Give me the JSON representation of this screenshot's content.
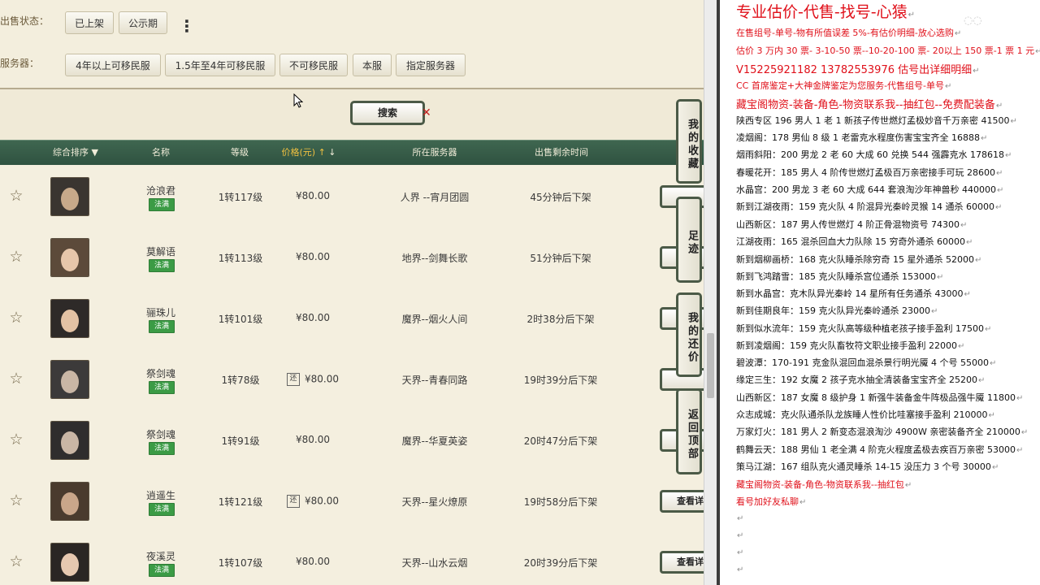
{
  "filters": {
    "sale_status_label": "出售状态：",
    "sale_status_options": [
      "已上架",
      "公示期"
    ],
    "server_label": "服务器：",
    "server_options": [
      "4年以上可移民服",
      "1.5年至4年可移民服",
      "不可移民服",
      "本服",
      "指定服务器"
    ]
  },
  "search_label": "搜索",
  "table": {
    "headers": [
      "综合排序",
      "名称",
      "等级",
      "价格(元)",
      "所在服务器",
      "出售剩余时间"
    ],
    "rows": [
      {
        "name": "沧浪君",
        "tag": "法满",
        "level": "1转117级",
        "price": "¥80.00",
        "huan": "",
        "server": "人界 --宵月团圆",
        "time": "45分钟后下架",
        "btn": ""
      },
      {
        "name": "莫解语",
        "tag": "法满",
        "level": "1转113级",
        "price": "¥80.00",
        "huan": "",
        "server": "地界--剑舞长歌",
        "time": "51分钟后下架",
        "btn": ""
      },
      {
        "name": "骊珠儿",
        "tag": "法满",
        "level": "1转101级",
        "price": "¥80.00",
        "huan": "",
        "server": "魔界--烟火人间",
        "time": "2时38分后下架",
        "btn": ""
      },
      {
        "name": "祭剑魂",
        "tag": "法满",
        "level": "1转78级",
        "price": "¥80.00",
        "huan": "还",
        "server": "天界--青春同路",
        "time": "19时39分后下架",
        "btn": ""
      },
      {
        "name": "祭剑魂",
        "tag": "法满",
        "level": "1转91级",
        "price": "¥80.00",
        "huan": "",
        "server": "魔界--华夏英姿",
        "time": "20时47分后下架",
        "btn": ""
      },
      {
        "name": "逍遥生",
        "tag": "法满",
        "level": "1转121级",
        "price": "¥80.00",
        "huan": "还",
        "server": "天界--星火燎原",
        "time": "19时58分后下架",
        "btn": "查看详"
      },
      {
        "name": "夜溪灵",
        "tag": "法满",
        "level": "1转107级",
        "price": "¥80.00",
        "huan": "",
        "server": "天界--山水云烟",
        "time": "20时39分后下架",
        "btn": "查看详"
      }
    ]
  },
  "side_tabs": [
    "我的收藏",
    "足迹",
    "我的还价",
    "返回顶部"
  ],
  "doc": {
    "lines": [
      {
        "text": "专业估价-代售-找号-心猿",
        "style": "red big"
      },
      {
        "text": "在售组号-单号-物有所值误差 5%-有估价明细-放心选购",
        "style": "red"
      },
      {
        "text": "估价 3 万内 30 票- 3-10-50 票--10-20-100 票- 20以上 150 票-1 票 1 元",
        "style": "red"
      },
      {
        "text": "V15225921182     13782553976    估号出详细明细",
        "style": "red mid"
      },
      {
        "text": "CC 首席鉴定+大神金牌鉴定为您服务-代售组号-单号",
        "style": "red"
      },
      {
        "text": "藏宝阁物资-装备-角色-物资联系我--抽红包--免费配装备",
        "style": "red mid"
      },
      {
        "text": "陕西专区 196 男人 1 老 1 新孩子传世燃灯孟极妙音千万亲密 41500",
        "style": ""
      },
      {
        "text": "凌烟阁：178 男仙 8 级 1 老雷克水程度伤害宝宝齐全 16888",
        "style": ""
      },
      {
        "text": "烟雨斜阳：200 男龙 2 老 60 大成 60 兑换 544 强霹克水 178618",
        "style": ""
      },
      {
        "text": "春暖花开：185 男人 4 阶传世燃灯孟极百万亲密接手可玩 28600",
        "style": ""
      },
      {
        "text": "水晶宫：200 男龙 3 老 60 大成 644 套浪淘沙年神兽秒 440000",
        "style": ""
      },
      {
        "text": "新到江湖夜雨：159 克火队 4 阶混异光秦岭灵猴 14 通杀 60000",
        "style": ""
      },
      {
        "text": "山西新区：187 男人传世燃灯 4 阶正骨混物资号 74300",
        "style": ""
      },
      {
        "text": "江湖夜雨：165 混杀回血大力队除 15 穷奇外通杀 60000",
        "style": ""
      },
      {
        "text": "新到烟柳画桥：168 克火队睡杀除穷奇 15 星外通杀 52000",
        "style": ""
      },
      {
        "text": "新到飞鸿踏雪：185 克火队睡杀宫位通杀 153000",
        "style": ""
      },
      {
        "text": "新到水晶宫：克木队异光秦岭 14 星所有任务通杀 43000",
        "style": ""
      },
      {
        "text": "新到佳期良年：159 克火队异光秦岭通杀 23000",
        "style": ""
      },
      {
        "text": "新到似水流年：159 克火队高等级种植老孩子接手盈利 17500",
        "style": ""
      },
      {
        "text": "新到凌烟阁：159 克火队畜牧符文职业接手盈利 22000",
        "style": ""
      },
      {
        "text": "碧波潭：170-191 克金队混回血混杀景行明光魇 4 个号 55000",
        "style": ""
      },
      {
        "text": "缘定三生：192 女魔 2 孩子克水抽全清装备宝宝齐全 25200",
        "style": ""
      },
      {
        "text": "山西新区：187 女魔 8 级护身 1 新强牛装备金牛阵极品强牛魇 11800",
        "style": ""
      },
      {
        "text": "众志成城：克火队通杀队龙族睡人性价比哇塞接手盈利 210000",
        "style": ""
      },
      {
        "text": "万家灯火：181 男人 2 新变态混浪淘沙 4900W 亲密装备齐全 210000",
        "style": ""
      },
      {
        "text": "鹤舞云天：188 男仙 1 老全满 4 阶克火程度孟极去疾百万亲密 53000",
        "style": ""
      },
      {
        "text": "策马江湖：167 组队克火通灵睡杀 14-15 没压力 3 个号 30000",
        "style": ""
      },
      {
        "text": "藏宝阁物资-装备-角色-物资联系我--抽红包",
        "style": "red"
      },
      {
        "text": "看号加好友私聊",
        "style": "red"
      },
      {
        "text": "",
        "style": ""
      },
      {
        "text": "",
        "style": ""
      },
      {
        "text": "",
        "style": ""
      },
      {
        "text": "",
        "style": ""
      }
    ]
  },
  "colors": {
    "header_bg": "#2f5240",
    "tag_green": "#3b9b45",
    "doc_red": "#e0101a"
  }
}
